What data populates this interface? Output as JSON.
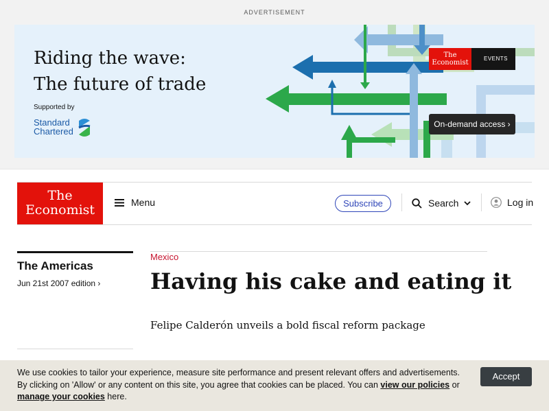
{
  "ad": {
    "label": "ADVERTISEMENT",
    "headline_line1": "Riding the wave:",
    "headline_line2": "The future of trade",
    "supported_by": "Supported by",
    "sponsor_line1": "Standard",
    "sponsor_line2": "Chartered",
    "brand_line1": "The",
    "brand_line2": "Economist",
    "brand_events": "EVENTS",
    "cta": "On-demand access ›",
    "colors": {
      "bg": "#e5f1fb",
      "blue": "#1c6fae",
      "green": "#2ca84a",
      "light_blue": "#8fb9de",
      "light_green": "#b8e1b8"
    }
  },
  "nav": {
    "logo_line1": "The",
    "logo_line2": "Economist",
    "menu": "Menu",
    "subscribe": "Subscribe",
    "search": "Search",
    "login": "Log in",
    "icons": [
      "hamburger-icon",
      "search-icon",
      "chevron-down-icon",
      "user-icon"
    ],
    "colors": {
      "brand_red": "#e3120b",
      "subscribe_blue": "#2e45b8"
    }
  },
  "article": {
    "section": "The Americas",
    "edition": "Jun 21st 2007 edition ›",
    "flytitle": "Mexico",
    "headline": "Having his cake and eating it",
    "standfirst": "Felipe Calderón unveils a bold fiscal reform package",
    "colors": {
      "flytitle_red": "#c6142f"
    }
  },
  "cookie": {
    "text_before": "We use cookies to tailor your experience, measure site performance and present relevant offers and advertisements. By clicking on 'Allow' or any content on this site, you agree that cookies can be placed. You can ",
    "link_policies": "view our policies",
    "text_or": " or ",
    "link_manage": "manage your cookies",
    "text_after": " here.",
    "accept": "Accept"
  }
}
